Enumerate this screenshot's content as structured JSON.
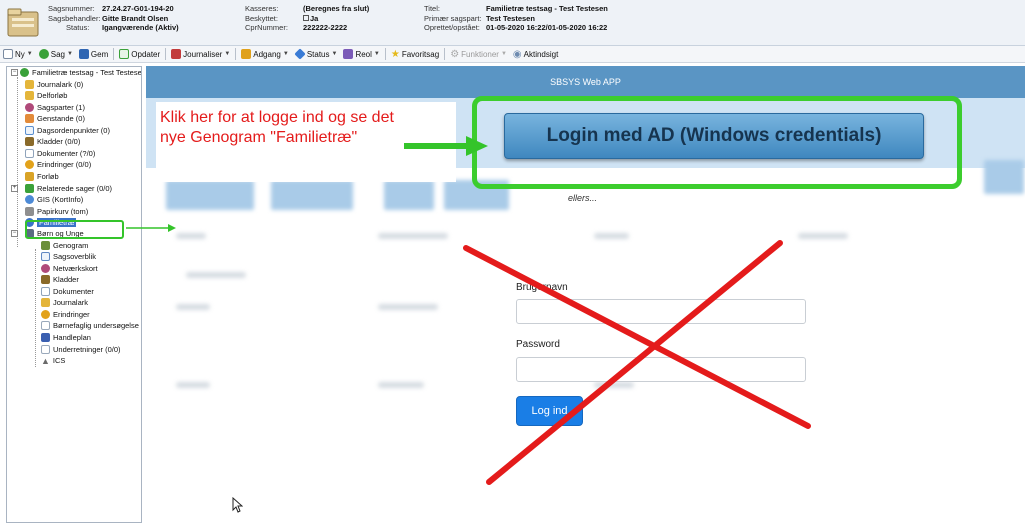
{
  "header": {
    "sagsnummer_label": "Sagsnummer:",
    "sagsnummer": "27.24.27-G01-194-20",
    "sagsbehandler_label": "Sagsbehandler:",
    "sagsbehandler": "Gitte Brandt Olsen",
    "status_label": "Status:",
    "status": "Igangværende (Aktiv)",
    "kasseres_label": "Kasseres:",
    "kasseres": "(Beregnes fra slut)",
    "beskyttet_label": "Beskyttet:",
    "beskyttet": "Ja",
    "cprnummer_label": "CprNummer:",
    "cprnummer": "222222-2222",
    "titel_label": "Titel:",
    "titel": "Familietræ testsag - Test Testesen",
    "primaer_label": "Primær sagspart:",
    "primaer": "Test Testesen",
    "oprettet_label": "Oprettet/opstået:",
    "oprettet": "01-05-2020 16:22/01-05-2020 16:22"
  },
  "toolbar": {
    "items": [
      {
        "label": "Ny",
        "dropdown": true,
        "icon": "new-document-icon",
        "color": "#7a8aa0"
      },
      {
        "label": "Sag",
        "dropdown": true,
        "icon": "case-icon",
        "color": "#3aa13a"
      },
      {
        "label": "Gem",
        "dropdown": false,
        "icon": "save-icon",
        "color": "#2f66b3"
      },
      {
        "label": "Opdater",
        "dropdown": false,
        "icon": "refresh-icon",
        "color": "#3aa13a"
      },
      {
        "label": "Journaliser",
        "dropdown": true,
        "icon": "journal-icon",
        "color": "#c23b3b"
      },
      {
        "label": "Adgang",
        "dropdown": true,
        "icon": "access-icon",
        "color": "#e0a11b"
      },
      {
        "label": "Status",
        "dropdown": true,
        "icon": "status-icon",
        "color": "#3a7bd5"
      },
      {
        "label": "Reol",
        "dropdown": true,
        "icon": "shelf-icon",
        "color": "#7b5bb8"
      },
      {
        "label": "Favoritsag",
        "dropdown": false,
        "icon": "star-icon",
        "color": "#e5b91a"
      },
      {
        "label": "Funktioner",
        "dropdown": true,
        "icon": "functions-icon",
        "color": "#aaaaaa",
        "disabled": true
      },
      {
        "label": "Aktindsigt",
        "dropdown": false,
        "icon": "eye-icon",
        "color": "#6e8bb0"
      }
    ]
  },
  "tree": {
    "root": "Familietræ testsag - Test Testesen",
    "items": [
      {
        "label": "Journalark (0)",
        "icon": "journal-icon",
        "color": "#e4b53a"
      },
      {
        "label": "Delforløb",
        "icon": "folder-icon",
        "color": "#e4b53a"
      },
      {
        "label": "Sagsparter (1)",
        "icon": "people-icon",
        "color": "#b04a7a"
      },
      {
        "label": "Genstande (0)",
        "icon": "items-icon",
        "color": "#e38b3a"
      },
      {
        "label": "Dagsordenpunkter (0)",
        "icon": "agenda-icon",
        "color": "#5a8fd0"
      },
      {
        "label": "Kladder (0/0)",
        "icon": "draft-icon",
        "color": "#8a6a2a"
      },
      {
        "label": "Dokumenter (?/0)",
        "icon": "document-icon",
        "color": "#8fa3bb"
      },
      {
        "label": "Erindringer (0/0)",
        "icon": "reminder-icon",
        "color": "#e2a21b"
      },
      {
        "label": "Forløb",
        "icon": "process-icon",
        "color": "#d9a326"
      },
      {
        "label": "Relaterede sager (0/0)",
        "icon": "related-icon",
        "color": "#3aa13a"
      },
      {
        "label": "GIS (KortInfo)",
        "icon": "globe-icon",
        "color": "#4d8ad6"
      },
      {
        "label": "Papirkurv (tom)",
        "icon": "trash-icon",
        "color": "#8f8f8f"
      },
      {
        "label": "Familietræ",
        "icon": "family-tree-icon",
        "color": "#3a73c8",
        "selected": true
      },
      {
        "label": "Børn og Unge",
        "icon": "children-icon",
        "color": "#5a6c82"
      },
      {
        "label": "Genogram",
        "icon": "genogram-icon",
        "color": "#6b8f3a"
      },
      {
        "label": "Sagsoverblik",
        "icon": "overview-icon",
        "color": "#5f86c2"
      },
      {
        "label": "Netværkskort",
        "icon": "network-icon",
        "color": "#b04a7a"
      },
      {
        "label": "Kladder",
        "icon": "draft-icon",
        "color": "#8a6a2a"
      },
      {
        "label": "Dokumenter",
        "icon": "document-icon",
        "color": "#8fa3bb"
      },
      {
        "label": "Journalark",
        "icon": "journal-icon",
        "color": "#e4b53a"
      },
      {
        "label": "Erindringer",
        "icon": "reminder-icon",
        "color": "#e2a21b"
      },
      {
        "label": "Børnefaglig undersøgelse",
        "icon": "report-icon",
        "color": "#9aa9bb"
      },
      {
        "label": "Handleplan",
        "icon": "plan-icon",
        "color": "#3a5fb0"
      },
      {
        "label": "Underretninger (0/0)",
        "icon": "notification-icon",
        "color": "#9aa9bb"
      },
      {
        "label": "ICS",
        "icon": "ics-icon",
        "color": "#6a6a6a"
      }
    ]
  },
  "app": {
    "title": "SBSYS Web APP",
    "login_ad_label": "Login med AD (Windows credentials)",
    "instruction_line1": "Klik her for at logge ind og se det",
    "instruction_line2": "nye Genogram \"Familietræ\"",
    "ellers": "ellers...",
    "username_label": "Brugernavn",
    "username_value": "",
    "password_label": "Password",
    "password_value": "",
    "submit_label": "Log ind"
  },
  "colors": {
    "app_header": "#5a95c4",
    "annotation_green": "#3ccd2e",
    "annotation_red": "#e41b1b",
    "submit": "#1a7ee6"
  }
}
